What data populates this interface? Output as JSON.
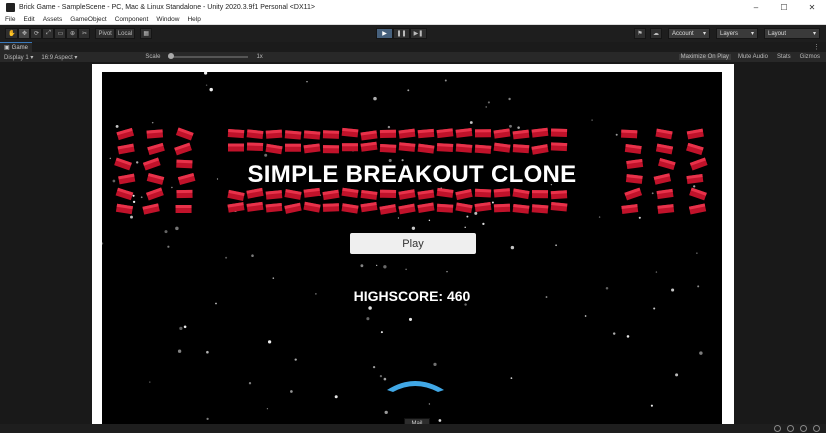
{
  "window": {
    "title": "Brick Game - SampleScene - PC, Mac & Linux Standalone - Unity 2020.3.9f1 Personal <DX11>",
    "minimize": "–",
    "maximize": "☐",
    "close": "✕"
  },
  "menu": [
    "File",
    "Edit",
    "Assets",
    "GameObject",
    "Component",
    "Window",
    "Help"
  ],
  "toolbar": {
    "tools": [
      "hand-tool",
      "move-tool",
      "rotate-tool",
      "scale-tool",
      "rect-tool",
      "transform-tool",
      "custom-tool"
    ],
    "pivot_label": "Pivot",
    "local_label": "Local",
    "account_label": "Account",
    "layers_label": "Layers",
    "layout_label": "Layout"
  },
  "tab": {
    "label": "Game"
  },
  "gamebar": {
    "display": "Display 1",
    "aspect": "16:9 Aspect",
    "scale_label": "Scale",
    "scale_value": "1x",
    "maximize_on_play": "Maximize On Play",
    "mute_audio": "Mute Audio",
    "stats": "Stats",
    "gizmos": "Gizmos"
  },
  "game": {
    "title": "SIMPLE BREAKOUT CLONE",
    "play_label": "Play",
    "highscore": "HIGHSCORE: 460"
  },
  "tooltip": "Mail",
  "colors": {
    "brick": "#c0122a",
    "brick_light": "#e8324a",
    "play_accent": "#46607c",
    "paddle": "#41a8e6"
  }
}
